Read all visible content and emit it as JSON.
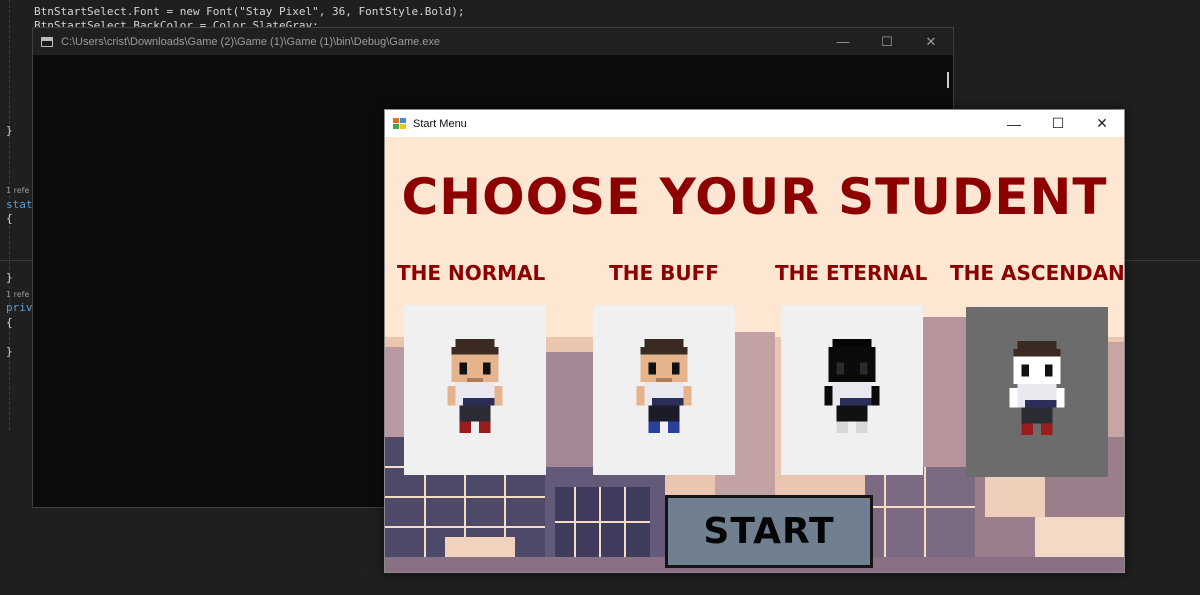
{
  "editor": {
    "line1": "BtnStartSelect.Font = new Font(\"Stay Pixel\", 36, FontStyle.Bold);",
    "line2": "BtnStartSelect.BackColor = Color.SlateGray;",
    "ref1": "1 refe",
    "code1": "stat",
    "ref2": "1 refe",
    "code2": "priv"
  },
  "console": {
    "title": "C:\\Users\\crist\\Downloads\\Game (2)\\Game (1)\\Game (1)\\bin\\Debug\\Game.exe"
  },
  "start_menu": {
    "title": "Start Menu",
    "headline": "CHOOSE YOUR STUDENT",
    "students": [
      {
        "name": "THE NORMAL",
        "icon": "student-normal-icon"
      },
      {
        "name": "THE BUFF",
        "icon": "student-buff-icon"
      },
      {
        "name": "THE ETERNAL",
        "icon": "student-eternal-icon"
      },
      {
        "name": "THE ASCENDANT",
        "icon": "student-ascendant-icon",
        "selected": true
      }
    ],
    "start_label": "START"
  },
  "colors": {
    "title_red": "#8d0000",
    "button_slategray": "#708090",
    "background_cream": "#fde7d2",
    "selected_card": "#6c6c6c"
  }
}
